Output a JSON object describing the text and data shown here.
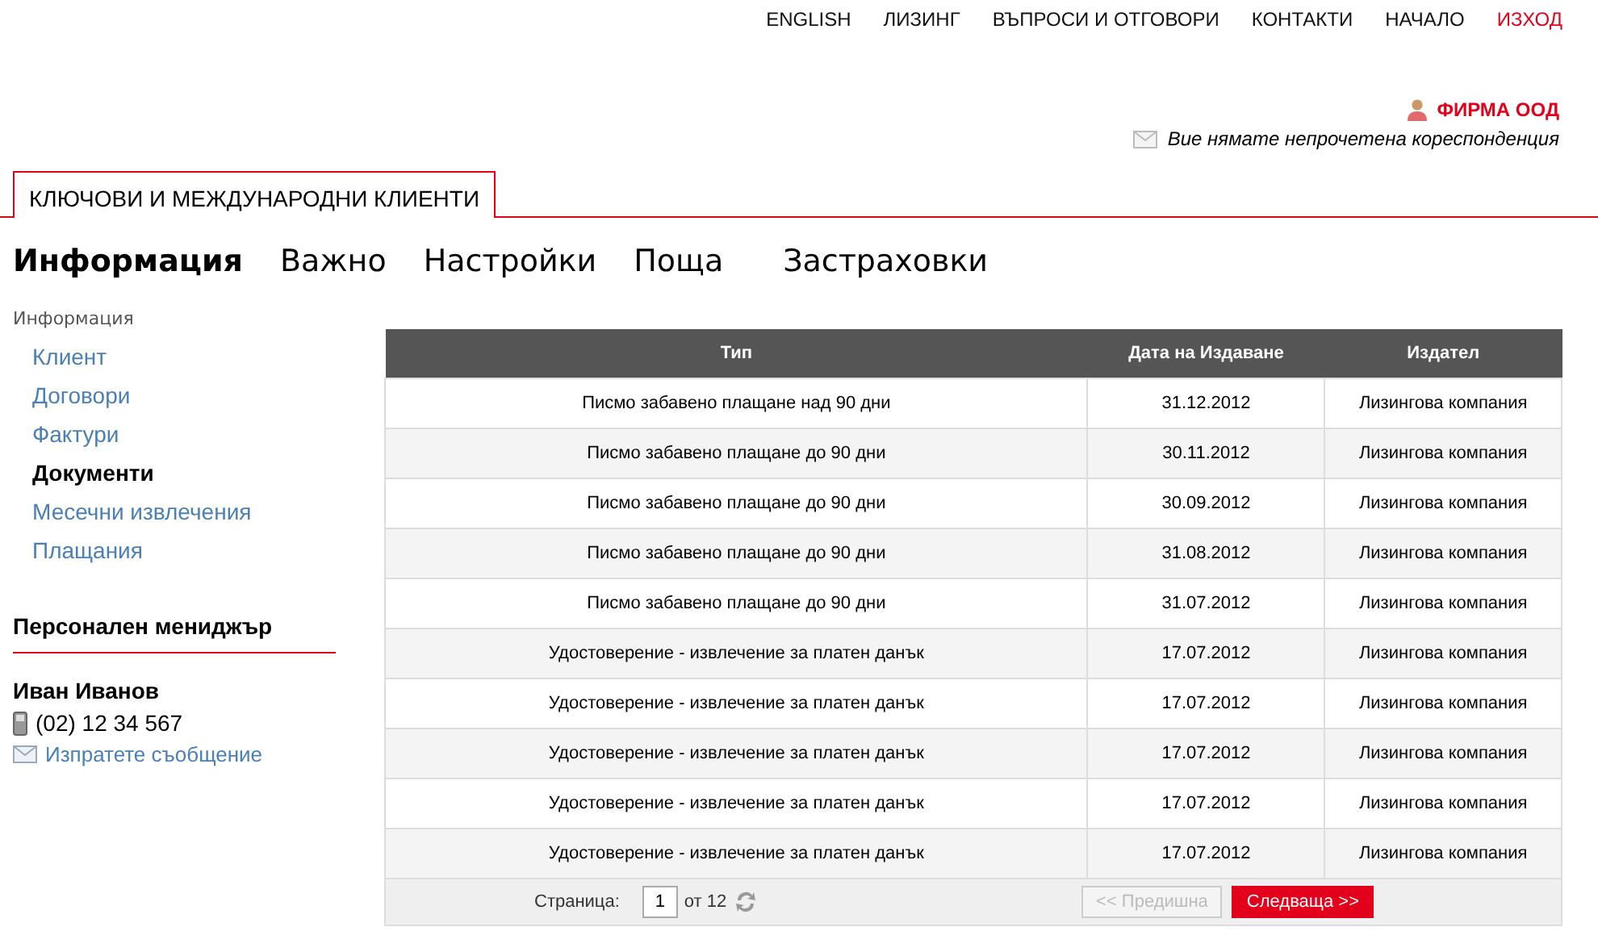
{
  "top_nav": [
    {
      "label": "ENGLISH",
      "kind": "link"
    },
    {
      "label": "ЛИЗИНГ",
      "kind": "link"
    },
    {
      "label": "ВЪПРОСИ И ОТГОВОРИ",
      "kind": "link"
    },
    {
      "label": "КОНТАКТИ",
      "kind": "link"
    },
    {
      "label": "НАЧАЛО",
      "kind": "link"
    },
    {
      "label": "ИЗХОД",
      "kind": "logout"
    }
  ],
  "account": {
    "company": "ФИРМА ООД",
    "mail_status": "Вие нямате непрочетена кореспонденция"
  },
  "section_tab": {
    "label": "КЛЮЧОВИ И МЕЖДУНАРОДНИ КЛИЕНТИ"
  },
  "sub_nav": [
    {
      "label": "Информация",
      "selected": true
    },
    {
      "label": "Важно",
      "selected": false
    },
    {
      "label": "Настройки",
      "selected": false
    },
    {
      "label": "Поща",
      "selected": false
    },
    {
      "label": "Застраховки",
      "selected": false
    }
  ],
  "sidebar": {
    "heading": "Информация",
    "items": [
      {
        "label": "Клиент",
        "selected": false
      },
      {
        "label": "Договори",
        "selected": false
      },
      {
        "label": "Фактури",
        "selected": false
      },
      {
        "label": "Документи",
        "selected": true
      },
      {
        "label": "Месечни извлечения",
        "selected": false
      },
      {
        "label": "Плащания",
        "selected": false
      }
    ],
    "manager": {
      "heading": "Персонален мениджър",
      "name": "Иван Иванов",
      "phone": "(02) 12 34 567",
      "message_link": "Изпратете съобщение"
    }
  },
  "table": {
    "columns": [
      "Тип",
      "Дата на Издаване",
      "Издател"
    ],
    "rows": [
      [
        "Писмо забавено плащане над 90 дни",
        "31.12.2012",
        "Лизингова компания"
      ],
      [
        "Писмо забавено плащане до 90 дни",
        "30.11.2012",
        "Лизингова компания"
      ],
      [
        "Писмо забавено плащане до 90 дни",
        "30.09.2012",
        "Лизингова компания"
      ],
      [
        "Писмо забавено плащане до 90 дни",
        "31.08.2012",
        "Лизингова компания"
      ],
      [
        "Писмо забавено плащане до 90 дни",
        "31.07.2012",
        "Лизингова компания"
      ],
      [
        "Удостоверение - извлечение за платен данък",
        "17.07.2012",
        "Лизингова компания"
      ],
      [
        "Удостоверение - извлечение за платен данък",
        "17.07.2012",
        "Лизингова компания"
      ],
      [
        "Удостоверение - извлечение за платен данък",
        "17.07.2012",
        "Лизингова компания"
      ],
      [
        "Удостоверение - извлечение за платен данък",
        "17.07.2012",
        "Лизингова компания"
      ],
      [
        "Удостоверение - извлечение за платен данък",
        "17.07.2012",
        "Лизингова компания"
      ]
    ]
  },
  "pager": {
    "label": "Страница:",
    "page": "1",
    "of": "от 12",
    "prev": {
      "label": "<< Предишна",
      "disabled": true
    },
    "next": {
      "label": "Следваща >>",
      "disabled": false
    }
  }
}
